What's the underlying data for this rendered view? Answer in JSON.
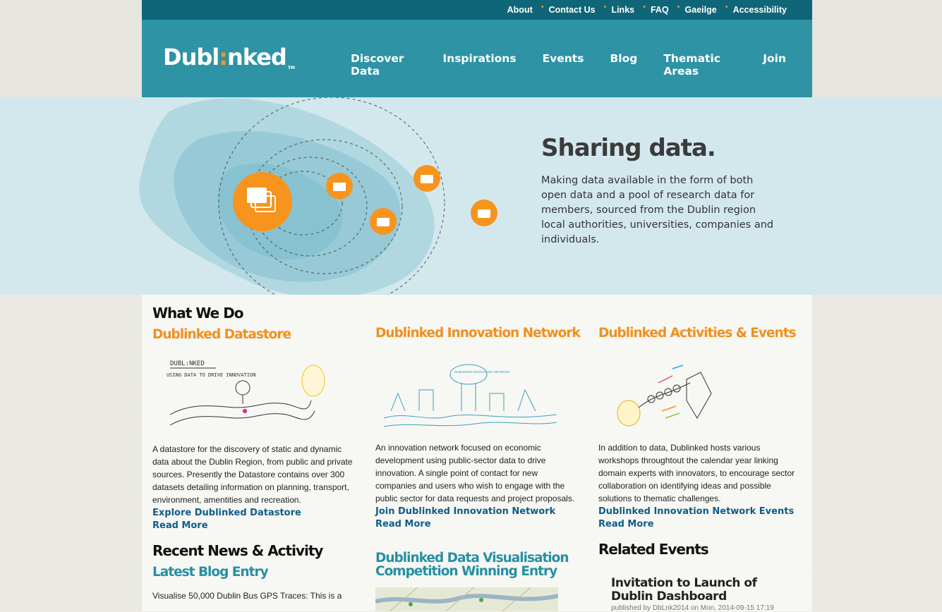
{
  "top_links": [
    "About",
    "Contact Us",
    "Links",
    "FAQ",
    "Gaeilge",
    "Accessibility"
  ],
  "logo": {
    "text_a": "Dubl",
    "text_b": "nked",
    "tm": "TM"
  },
  "nav": [
    "Discover Data",
    "Inspirations",
    "Events",
    "Blog",
    "Thematic Areas",
    "Join"
  ],
  "hero": {
    "title": "Sharing data.",
    "text": "Making data available in the form of both open data and a pool of research data for members, sourced from the Dublin region local authorities, universities, companies and individuals."
  },
  "what_we_do": {
    "title": "What We Do"
  },
  "columns": [
    {
      "title": "Dublinked Datastore",
      "text": " A datastore for the discovery of static and dynamic data about the Dublin Region, from public and private sources. Presently the Datastore contains over 300 datasets detailing information on planning, transport, environment, amentities and recreation.",
      "link1": "Explore Dublinked Datastore",
      "link2": "Read More"
    },
    {
      "title": "Dublinked Innovation Network",
      "text": "An innovation network focused on economic development using public-sector data to drive innovation. A single point of contact for new companies and users who wish to engage with the public sector for data requests and project proposals.",
      "link1": "Join Dublinked Innovation Network",
      "link2": "Read More"
    },
    {
      "title": "Dublinked Activities & Events",
      "text": "In addition to data, Dublinked hosts various workshops throughtout the calendar year linking domain experts with innovators, to encourage sector collaboration on identifying ideas and possible solutions to thematic challenges.",
      "link1": "Dublinked Innovation Network Events",
      "link2": "Read More"
    }
  ],
  "illu_labels": {
    "datastore_logo": "DUBL:NKED",
    "datastore_caption": "USING DATA TO DRIVE INNOVATION",
    "network_sign": "DUBLINKED INNOVATION NETWORK"
  },
  "recent": {
    "title": "Recent News & Activity",
    "sub": "Latest Blog Entry",
    "text": "Visualise 50,000 Dublin Bus GPS Traces: This is a"
  },
  "visualisation": {
    "title_line1": "Dublinked Data Visualisation",
    "title_line2": "Competition Winning Entry"
  },
  "related": {
    "title": "Related Events",
    "event_title": "Invitation to Launch of Dublin Dashboard",
    "event_meta": "published by DbLnk2014 on Mon, 2014-09-15 17:19"
  },
  "colors": {
    "teal": "#2e93a5",
    "dark_teal": "#0f6678",
    "orange": "#f7941d",
    "link": "#0f5d86"
  }
}
